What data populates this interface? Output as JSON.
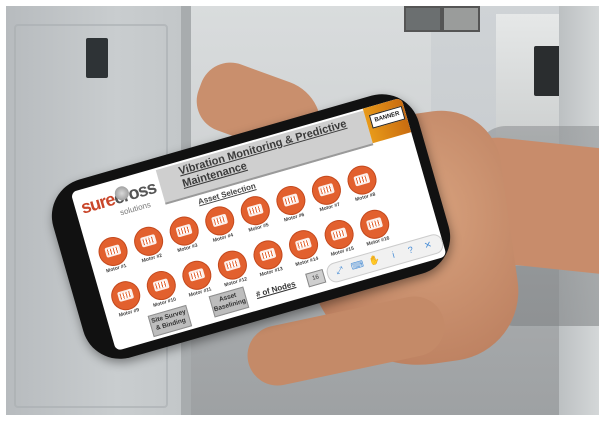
{
  "app": {
    "logo_main_a": "sure",
    "logo_main_b": "cross",
    "logo_sub": "solutions",
    "title": "Vibration Monitoring & Predictive Maintenance",
    "brand": "BANNER"
  },
  "asset_selection": {
    "heading": "Asset Selection",
    "row1": [
      "Motor #1",
      "Motor #2",
      "Motor #3",
      "Motor #4",
      "Motor #5",
      "Motor #6",
      "Motor #7",
      "Motor #8"
    ],
    "row2": [
      "Motor #9",
      "Motor #10",
      "Motor #11",
      "Motor #12",
      "Motor #13",
      "Motor #14",
      "Motor #15",
      "Motor #16"
    ]
  },
  "buttons": {
    "site_survey": "Site Survey & Binding",
    "asset_baselining": "Asset Baselining",
    "nodes_label": "# of Nodes",
    "nodes_value": "16"
  },
  "toolbar": {
    "icons": [
      "expand-icon",
      "keyboard-icon",
      "hand-icon",
      "info-icon",
      "help-icon",
      "close-icon"
    ]
  },
  "colors": {
    "accent": "#e2602e",
    "title_bar": "#cfcfcf",
    "brand_strip": "#e89a1a"
  }
}
